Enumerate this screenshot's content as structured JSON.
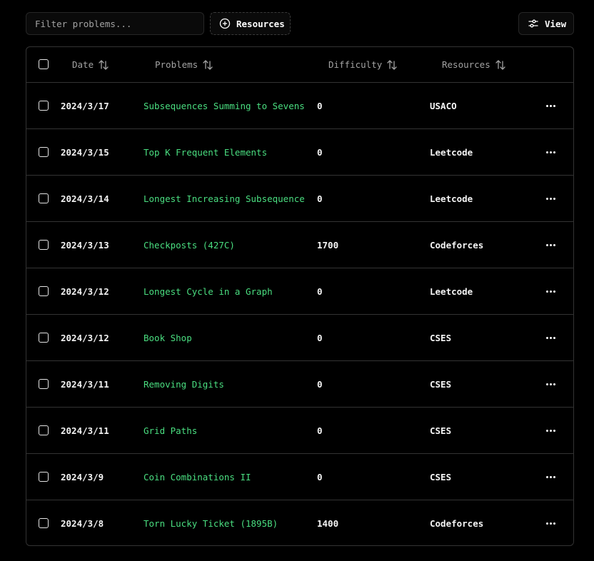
{
  "toolbar": {
    "filter_placeholder": "Filter problems...",
    "resources_label": "Resources",
    "view_label": "View"
  },
  "table": {
    "headers": {
      "date": "Date",
      "problems": "Problems",
      "difficulty": "Difficulty",
      "resources": "Resources"
    },
    "rows": [
      {
        "date": "2024/3/17",
        "problem": "Subsequences Summing to Sevens",
        "difficulty": "0",
        "resource": "USACO"
      },
      {
        "date": "2024/3/15",
        "problem": "Top K Frequent Elements",
        "difficulty": "0",
        "resource": "Leetcode"
      },
      {
        "date": "2024/3/14",
        "problem": "Longest Increasing Subsequence",
        "difficulty": "0",
        "resource": "Leetcode"
      },
      {
        "date": "2024/3/13",
        "problem": "Checkposts (427C)",
        "difficulty": "1700",
        "resource": "Codeforces"
      },
      {
        "date": "2024/3/12",
        "problem": "Longest Cycle in a Graph",
        "difficulty": "0",
        "resource": "Leetcode"
      },
      {
        "date": "2024/3/12",
        "problem": "Book Shop",
        "difficulty": "0",
        "resource": "CSES"
      },
      {
        "date": "2024/3/11",
        "problem": "Removing Digits",
        "difficulty": "0",
        "resource": "CSES"
      },
      {
        "date": "2024/3/11",
        "problem": "Grid Paths",
        "difficulty": "0",
        "resource": "CSES"
      },
      {
        "date": "2024/3/9",
        "problem": "Coin Combinations II",
        "difficulty": "0",
        "resource": "CSES"
      },
      {
        "date": "2024/3/8",
        "problem": "Torn Lucky Ticket (1895B)",
        "difficulty": "1400",
        "resource": "Codeforces"
      }
    ]
  },
  "colors": {
    "background": "#000000",
    "border": "#333333",
    "problem_link": "#4ade80",
    "muted_text": "#a3a3a3"
  },
  "icons": {
    "resources": "plus-circle-icon",
    "view": "sliders-icon",
    "sort": "sort-arrows-icon",
    "row_menu": "more-horizontal-icon"
  }
}
